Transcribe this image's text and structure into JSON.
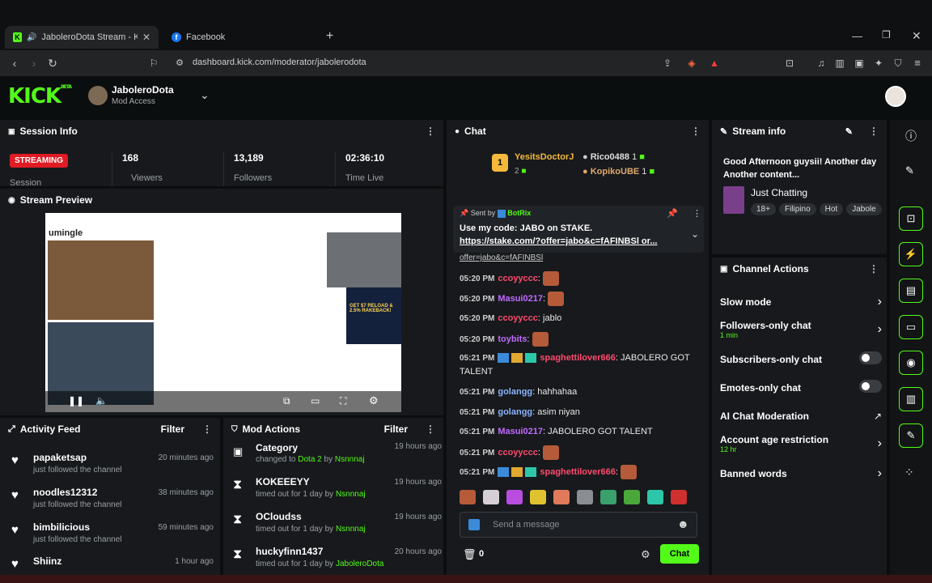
{
  "browser": {
    "tabs": [
      {
        "label": "JaboleroDota Stream - Kick D",
        "icon": "kick-icon"
      },
      {
        "label": "Facebook",
        "icon": "facebook-icon"
      }
    ],
    "new_tab": "+",
    "url": "dashboard.kick.com/moderator/jabolerodota"
  },
  "header": {
    "logo": "KICK",
    "logo_sup": "BETA",
    "channel_name": "JaboleroDota",
    "access": "Mod Access"
  },
  "session_info": {
    "title": "Session Info",
    "status": "STREAMING",
    "stats": [
      {
        "value": "168",
        "label": "Viewers"
      },
      {
        "value": "13,189",
        "label": "Followers"
      },
      {
        "value": "02:36:10",
        "label": "Time Live"
      }
    ],
    "session_label": "Session"
  },
  "stream_preview": {
    "title": "Stream Preview",
    "site_name": "umingle",
    "overlay_text": "GET $7 RELOAD & 2.5% RAKEBACK!"
  },
  "activity_feed": {
    "title": "Activity Feed",
    "filter": "Filter",
    "items": [
      {
        "name": "papaketsap",
        "sub": "just followed the channel",
        "time": "20 minutes ago"
      },
      {
        "name": "noodles12312",
        "sub": "just followed the channel",
        "time": "38 minutes ago"
      },
      {
        "name": "bimbilicious",
        "sub": "just followed the channel",
        "time": "59 minutes ago"
      },
      {
        "name": "Shiinz",
        "sub": "",
        "time": "1 hour ago"
      }
    ]
  },
  "mod_actions": {
    "title": "Mod Actions",
    "filter": "Filter",
    "top": {
      "name": "Category",
      "sub_prefix": "changed to ",
      "sub_value": "Dota 2",
      "sub_by": " by ",
      "sub_user": "Nsnnnaj",
      "time": "19 hours ago"
    },
    "items": [
      {
        "name": "KOKEEEYY",
        "sub": "timed out for 1 day by ",
        "by": "Nsnnnaj",
        "time": "19 hours ago"
      },
      {
        "name": "OCloudss",
        "sub": "timed out for 1 day by ",
        "by": "Nsnnnaj",
        "time": "19 hours ago"
      },
      {
        "name": "huckyfinn1437",
        "sub": "timed out for 1 day by ",
        "by": "JaboleroDota",
        "time": "20 hours ago"
      }
    ]
  },
  "chat": {
    "title": "Chat",
    "leaderboard": [
      {
        "rank": "1",
        "name": "YesitsDoctorJ",
        "count": "2"
      },
      {
        "name": "Rico0488",
        "count": "1"
      },
      {
        "name": "KopikoUBE",
        "count": "1"
      }
    ],
    "pinned": {
      "sent_by": "Sent by",
      "bot": "BotRix",
      "line1": "Use my code: JABO on STAKE.",
      "line2": "https://stake.com/?offer=jabo&c=fAFINBSl or...",
      "overflow": "offer=jabo&c=fAFINBSl"
    },
    "messages": [
      {
        "time": "05:20 PM",
        "user": "ccoyyccc",
        "text": "",
        "emote": true,
        "color": "#ff4a6e"
      },
      {
        "time": "05:20 PM",
        "user": "Masui0217",
        "text": "",
        "emote": true,
        "color": "#c06bff"
      },
      {
        "time": "05:20 PM",
        "user": "ccoyyccc",
        "text": "jablo",
        "emote": false,
        "color": "#ff4a6e"
      },
      {
        "time": "05:20 PM",
        "user": "toybits",
        "text": "",
        "emote": true,
        "color": "#c06bff"
      },
      {
        "time": "05:21 PM",
        "user": "spaghettilover666",
        "text": "JABOLERO GOT TALENT",
        "emote": false,
        "color": "#ff4a6e"
      },
      {
        "time": "05:21 PM",
        "user": "golangg",
        "text": "hahhahaa",
        "emote": false,
        "color": "#8ab4ff"
      },
      {
        "time": "05:21 PM",
        "user": "golangg",
        "text": "asim niyan",
        "emote": false,
        "color": "#8ab4ff"
      },
      {
        "time": "05:21 PM",
        "user": "Masui0217",
        "text": "JABOLERO GOT TALENT",
        "emote": false,
        "color": "#c06bff"
      },
      {
        "time": "05:21 PM",
        "user": "ccoyyccc",
        "text": "",
        "emote": true,
        "color": "#ff4a6e"
      },
      {
        "time": "05:21 PM",
        "user": "spaghettilover666",
        "text": "",
        "emote": true,
        "color": "#ff4a6e"
      }
    ],
    "placeholder": "Send a message",
    "count": "0",
    "send": "Chat"
  },
  "stream_info": {
    "title": "Stream info",
    "stream_title": "Good Afternoon guysii! Another day Another content...",
    "category": "Just Chatting",
    "tags": [
      "18+",
      "Filipino",
      "Hot",
      "Jabole"
    ]
  },
  "channel_actions": {
    "title": "Channel Actions",
    "rows": [
      {
        "label": "Slow mode",
        "sub": "",
        "control": "chevron"
      },
      {
        "label": "Followers-only chat",
        "sub": "1 min",
        "control": "chevron"
      },
      {
        "label": "Subscribers-only chat",
        "sub": "",
        "control": "toggle"
      },
      {
        "label": "Emotes-only chat",
        "sub": "",
        "control": "toggle"
      },
      {
        "label": "AI Chat Moderation",
        "sub": "",
        "control": "external"
      },
      {
        "label": "Account age restriction",
        "sub": "12 hr",
        "control": "chevron"
      },
      {
        "label": "Banned words",
        "sub": "",
        "control": "chevron"
      }
    ]
  },
  "colors": {
    "accent": "#53fc18",
    "streaming": "#e01b24",
    "panel": "#17191c"
  }
}
